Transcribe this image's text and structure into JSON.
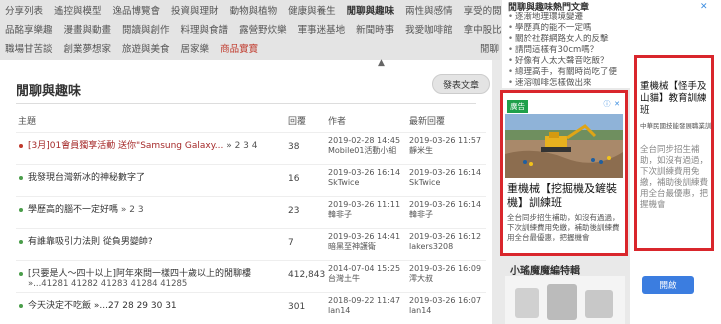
{
  "nav": {
    "row1": [
      "分享列表",
      "遙控與模型",
      "逸品博覽會",
      "投資與理財",
      "動物與植物",
      "健康與養生",
      "閒聊與趣味",
      "兩性與感情",
      "享受的閱讀"
    ],
    "row2": [
      "品酩享樂趣",
      "漫畫與動畫",
      "閱讀與創作",
      "料理與食譜",
      "露營野炊樂",
      "軍事迷基地",
      "新聞時事",
      "我愛咖啡館",
      "拿中股比例"
    ],
    "row3": [
      "職場甘苦談",
      "創業夢想家",
      "旅遊與美食",
      "居家樂",
      "商品實寶"
    ],
    "extra": "閒聊",
    "active": "閒聊與趣味",
    "hot": "商品實寶"
  },
  "hot_panel": {
    "title": "閒聊與趣味熱門文章",
    "items": [
      "逐漸地理環境變遷",
      "學歷真的能不一定嗎",
      "關於社群網路女人的反擊",
      "請問這樣有30cm嗎？",
      "好像有人太大聲音吃飯？",
      "總理高手，有關時尚吃了便",
      "速溶咖啡怎樣做出來"
    ]
  },
  "main": {
    "title": "閒聊與趣味",
    "post_button": "發表文章",
    "arrow": "▲",
    "columns": {
      "topic": "主題",
      "reply": "回覆",
      "author": "作者",
      "latest": "最新回覆"
    },
    "rows": [
      {
        "topic": "[3月]01會員獨享活動 送你\"Samsung Galaxy...",
        "pages": "» 2 3 4",
        "topic2": "",
        "reply": "38",
        "author_date": "2019-02-28 14:45",
        "author": "Mobile01活動小組",
        "latest_date": "2019-03-26 11:57",
        "latest_user": "靜米生",
        "hot": true
      },
      {
        "topic": "我發現台灣新冰的神秘數字了",
        "pages": "",
        "topic2": "",
        "reply": "16",
        "author_date": "2019-03-26 16:14",
        "author": "SkTwice",
        "latest_date": "2019-03-26 16:14",
        "latest_user": "SkTwice",
        "hot": false
      },
      {
        "topic": "學歷高的腦不一定好嗎",
        "pages": "» 2 3",
        "topic2": "",
        "reply": "23",
        "author_date": "2019-03-26 11:11",
        "author": "韓非子",
        "latest_date": "2019-03-26 16:14",
        "latest_user": "韓非子",
        "hot": false
      },
      {
        "topic": "有誰靠吸引力法則 從負男變帥?",
        "pages": "",
        "topic2": "",
        "reply": "7",
        "author_date": "2019-03-26 14:41",
        "author": "暗黑至神護衛",
        "latest_date": "2019-03-26 16:12",
        "latest_user": "lakers3208",
        "hot": false
      },
      {
        "topic": "[只要是人～四十以上]阿年來問一樣四十歲以上的閒聊樓",
        "pages": "",
        "topic2": "»...41281 41282 41283 41284 41285",
        "reply": "412,843",
        "author_date": "2014-07-04 15:25",
        "author": "台灣土牛",
        "latest_date": "2019-03-26 16:09",
        "latest_user": "澪大叔",
        "hot": false
      },
      {
        "topic": "今天決定不吃飯 »...27 28 29 30 31",
        "pages": "",
        "topic2": "",
        "reply": "301",
        "author_date": "2018-09-22 11:47",
        "author": "lan14",
        "latest_date": "2019-03-26 16:07",
        "latest_user": "lan14",
        "hot": false
      }
    ]
  },
  "ad1": {
    "badge": "廣告",
    "headline": "重機械【挖掘機及鏟裝機】訓練班",
    "body": "全台同步招生補助，如沒有過過，下次訓練費用免繳，補助後訓練費用全台最優惠，把握機會"
  },
  "below": {
    "title": "小瑤魔魔編特輯"
  },
  "ad2": {
    "close": "✕",
    "headline": "重機械【怪手及山貓】教育訓練班",
    "sub": "中華民國技能發展職業訓練協會",
    "body": "全台同步招生補助，如沒有過過，下次訓練費用免繳，補助後訓練費用全台最優惠，把握機會",
    "button": "開啟"
  },
  "colors": {
    "accent_red": "#d9262c",
    "hot_text": "#a52a2a",
    "ad_button": "#3b7de0",
    "ad_badge": "#1fa04a"
  }
}
